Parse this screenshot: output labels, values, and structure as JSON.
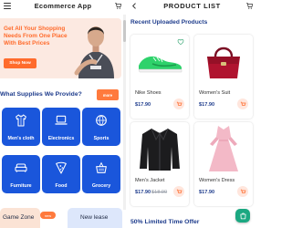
{
  "left_screen": {
    "title": "Ecommerce App",
    "banner": {
      "headline": "Get All Your Shopping Needs From One Place With Best Prices",
      "button_label": "Shop Now"
    },
    "categories_section": {
      "title": "What Supplies We Provide?",
      "more_label": "more",
      "items": [
        {
          "label": "Men's cloth",
          "icon": "shirt-icon"
        },
        {
          "label": "Electronics",
          "icon": "laptop-icon"
        },
        {
          "label": "Sports",
          "icon": "sports-icon"
        },
        {
          "label": "Furniture",
          "icon": "couch-icon"
        },
        {
          "label": "Food",
          "icon": "pizza-icon"
        },
        {
          "label": "Grocery",
          "icon": "grocery-basket-icon"
        }
      ]
    },
    "promos": [
      {
        "title": "Game Zone"
      },
      {
        "title": "New lease"
      }
    ],
    "promo_badge": "new"
  },
  "right_screen": {
    "title": "PRODUCT LIST",
    "section_title": "Recent Uploaded Products",
    "products": [
      {
        "name": "Nike Shoes",
        "price": "$17.90",
        "old_price": "",
        "image": "green-sneaker"
      },
      {
        "name": "Women's Suit",
        "price": "$17.90",
        "old_price": "",
        "image": "red-handbag"
      },
      {
        "name": "Men's Jacket",
        "price": "$17.90",
        "old_price": "$18.90",
        "image": "black-leather-jacket"
      },
      {
        "name": "Women's Dress",
        "price": "$17.90",
        "old_price": "",
        "image": "pink-dress"
      }
    ],
    "offer_title": "50% Limited Time Offer"
  },
  "colors": {
    "accent_orange": "#ff6b2c",
    "category_blue": "#1a56db",
    "heading_navy": "#1e3c8c",
    "banner_bg": "#fce9e1",
    "fab_green": "#1ba881"
  }
}
